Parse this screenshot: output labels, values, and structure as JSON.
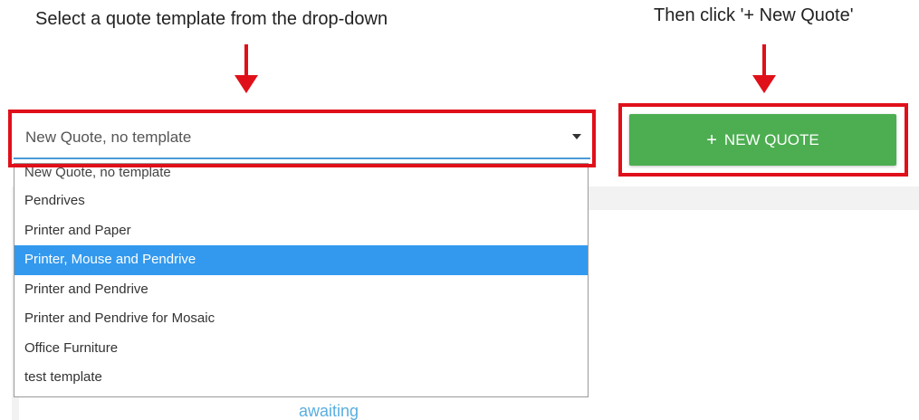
{
  "instructions": {
    "left": "Select a quote template from the drop-down",
    "right": "Then click '+ New Quote'"
  },
  "template_select": {
    "value": "New Quote, no template",
    "options": [
      "New Quote, no template",
      "Pendrives",
      "Printer and Paper",
      "Printer, Mouse and Pendrive",
      "Printer and Pendrive",
      "Printer and Pendrive for Mosaic",
      "Office Furniture",
      "test template"
    ],
    "highlighted_option": "Printer, Mouse and Pendrive"
  },
  "new_quote_button": {
    "icon": "+",
    "label": "NEW QUOTE"
  },
  "background": {
    "status_text": "awaiting"
  },
  "colors": {
    "highlight_box": "#e0101a",
    "button_green": "#4cae50",
    "selected_option": "#3399ee",
    "status_link": "#5aaee0"
  }
}
